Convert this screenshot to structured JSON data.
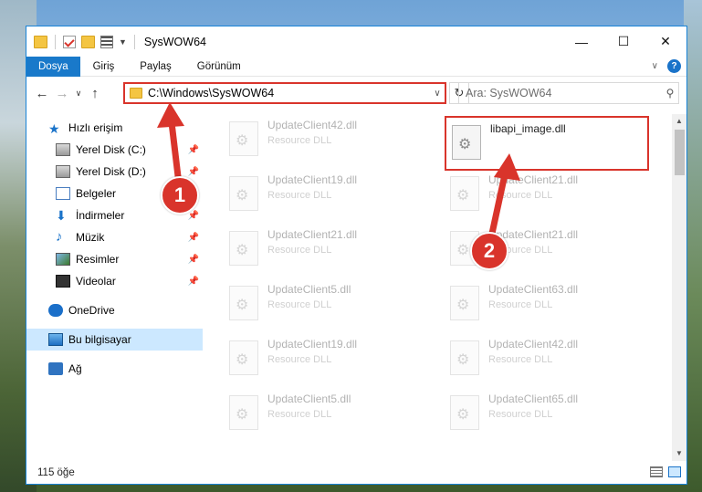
{
  "window": {
    "title": "SysWOW64",
    "controls": {
      "minimize": "—",
      "maximize": "☐",
      "close": "✕"
    }
  },
  "ribbon": {
    "tabs": [
      "Dosya",
      "Giriş",
      "Paylaş",
      "Görünüm"
    ],
    "help_label": "?"
  },
  "nav": {
    "address": "C:\\Windows\\SysWOW64",
    "search_placeholder": "Ara: SysWOW64"
  },
  "sidebar": {
    "items": [
      {
        "label": "Hızlı erişim",
        "icon": "quick-access-star-icon"
      },
      {
        "label": "Yerel Disk (C:)",
        "icon": "drive-icon",
        "pinned": true
      },
      {
        "label": "Yerel Disk (D:)",
        "icon": "drive-icon",
        "pinned": true
      },
      {
        "label": "Belgeler",
        "icon": "documents-icon",
        "pinned": true
      },
      {
        "label": "İndirmeler",
        "icon": "downloads-icon",
        "pinned": true
      },
      {
        "label": "Müzik",
        "icon": "music-icon",
        "pinned": true
      },
      {
        "label": "Resimler",
        "icon": "pictures-icon",
        "pinned": true
      },
      {
        "label": "Videolar",
        "icon": "videos-icon",
        "pinned": true
      },
      {
        "label": "OneDrive",
        "icon": "onedrive-icon"
      },
      {
        "label": "Bu bilgisayar",
        "icon": "this-pc-icon",
        "selected": true
      },
      {
        "label": "Ağ",
        "icon": "network-icon"
      }
    ]
  },
  "files": {
    "col1": [
      {
        "name": "UpdateClient42.dll",
        "type": "Resource DLL"
      },
      {
        "name": "UpdateClient19.dll",
        "type": "Resource DLL"
      },
      {
        "name": "UpdateClient21.dll",
        "type": "Resource DLL"
      },
      {
        "name": "UpdateClient5.dll",
        "type": "Resource DLL"
      },
      {
        "name": "UpdateClient19.dll",
        "type": "Resource DLL"
      },
      {
        "name": "UpdateClient5.dll",
        "type": "Resource DLL"
      }
    ],
    "col2": [
      {
        "name": "libapi_image.dll",
        "type": ""
      },
      {
        "name": "UpdateClient21.dll",
        "type": "Resource DLL"
      },
      {
        "name": "UpdateClient21.dll",
        "type": "Resource DLL"
      },
      {
        "name": "UpdateClient63.dll",
        "type": "Resource DLL"
      },
      {
        "name": "UpdateClient42.dll",
        "type": "Resource DLL"
      },
      {
        "name": "UpdateClient65.dll",
        "type": "Resource DLL"
      }
    ]
  },
  "status": {
    "item_count": "115 öğe"
  },
  "annotations": {
    "step1": "1",
    "step2": "2",
    "color": "#d9342b"
  }
}
